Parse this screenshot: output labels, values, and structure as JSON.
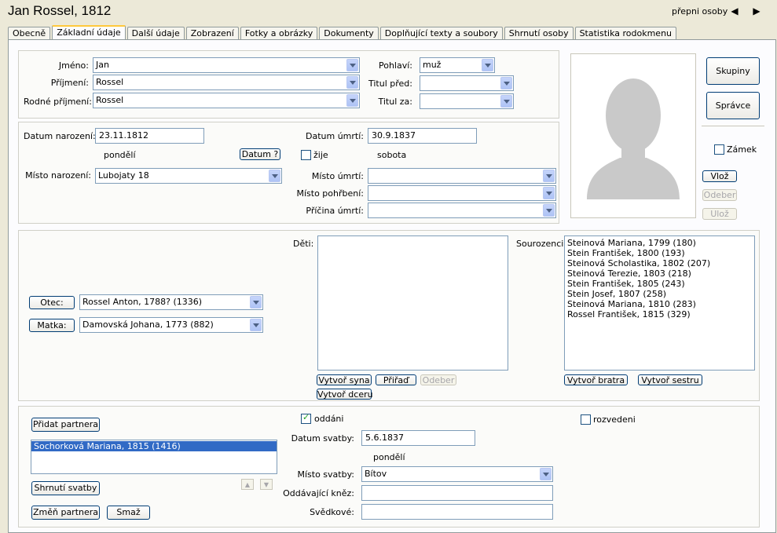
{
  "window": {
    "title": "Jan Rossel, 1812",
    "switch_label": "přepni osoby"
  },
  "tabs": [
    {
      "label": "Obecně"
    },
    {
      "label": "Základní údaje"
    },
    {
      "label": "Další údaje"
    },
    {
      "label": "Zobrazení"
    },
    {
      "label": "Fotky a obrázky"
    },
    {
      "label": "Dokumenty"
    },
    {
      "label": "Doplňující texty a soubory"
    },
    {
      "label": "Shrnutí osoby"
    },
    {
      "label": "Statistika rodokmenu"
    }
  ],
  "name": {
    "jmeno_label": "Jméno:",
    "jmeno": "Jan",
    "prijmeni_label": "Příjmení:",
    "prijmeni": "Rossel",
    "rodne_label": "Rodné příjmení:",
    "rodne": "Rossel",
    "pohlavi_label": "Pohlaví:",
    "pohlavi": "muž",
    "titul_pred_label": "Titul před:",
    "titul_pred": "",
    "titul_za_label": "Titul za:",
    "titul_za": ""
  },
  "birth": {
    "datum_label": "Datum narození:",
    "datum": "23.11.1812",
    "den": "pondělí",
    "datum_btn": "Datum ?",
    "misto_label": "Místo narození:",
    "misto": "Lubojaty 18"
  },
  "death": {
    "datum_label": "Datum úmrtí:",
    "datum": "30.9.1837",
    "zije_label": "žije",
    "den": "sobota",
    "misto_label": "Místo úmrtí:",
    "misto": "",
    "pohrbeni_label": "Místo pohřbení:",
    "pohrbeni": "",
    "pricina_label": "Příčina úmrtí:",
    "pricina": ""
  },
  "side": {
    "skupiny": "Skupiny",
    "spravce": "Správce",
    "zamek": "Zámek",
    "vloz": "Vlož",
    "odeber": "Odeber",
    "uloz": "Ulož"
  },
  "parents": {
    "otec_btn": "Otec:",
    "otec": "Rossel Anton, 1788? (1336)",
    "matka_btn": "Matka:",
    "matka": "Damovská Johana, 1773 (882)"
  },
  "children": {
    "label": "Děti:",
    "items": [],
    "vytvor_syna": "Vytvoř syna",
    "prirad": "Přiřaď",
    "odeber": "Odeber",
    "vytvor_dceru": "Vytvoř dceru"
  },
  "siblings": {
    "label": "Sourozenci:",
    "items": [
      "Steinová Mariana, 1799 (180)",
      "Stein František, 1800 (193)",
      "Steinová Scholastika, 1802 (207)",
      "Steinová Terezie, 1803 (218)",
      "Stein František, 1805 (243)",
      "Stein Josef, 1807 (258)",
      "Steinová Mariana, 1810 (283)",
      "Rossel František, 1815 (329)"
    ],
    "vytvor_bratra": "Vytvoř bratra",
    "vytvor_sestru": "Vytvoř sestru"
  },
  "marriage": {
    "pridat": "Přidat partnera",
    "partners": [
      "Sochorková Mariana, 1815 (1416)"
    ],
    "shrnuti": "Shrnutí svatby",
    "zmen": "Změň partnera",
    "smaz": "Smaž",
    "oddani_label": "oddáni",
    "rozvedeni_label": "rozvedeni",
    "datum_label": "Datum svatby:",
    "datum": "5.6.1837",
    "den": "pondělí",
    "misto_label": "Místo svatby:",
    "misto": "Bítov",
    "knez_label": "Oddávající kněz:",
    "knez": "",
    "svedkove_label": "Svědkové:",
    "svedkove": ""
  }
}
